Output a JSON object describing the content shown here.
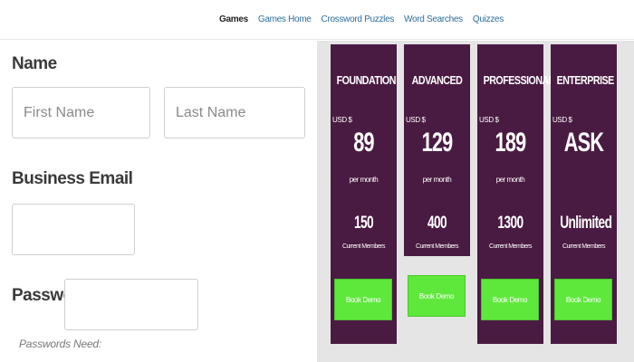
{
  "nav": {
    "items": [
      {
        "label": "Games",
        "active": true
      },
      {
        "label": "Games Home",
        "active": false
      },
      {
        "label": "Crossword Puzzles",
        "active": false
      },
      {
        "label": "Word Searches",
        "active": false
      },
      {
        "label": "Quizzes",
        "active": false
      }
    ]
  },
  "form": {
    "name_label": "Name",
    "first_name_placeholder": "First Name",
    "last_name_placeholder": "Last Name",
    "email_label": "Business Email",
    "password_label": "Password",
    "password_hint": "Passwords Need:"
  },
  "plans": [
    {
      "name": "FOUNDATION",
      "currency": "USD $",
      "price": "89",
      "period": "per month",
      "members": "150",
      "members_label": "Current Members",
      "cta": "Book Demo"
    },
    {
      "name": "ADVANCED",
      "currency": "USD $",
      "price": "129",
      "period": "per month",
      "members": "400",
      "members_label": "Current Members",
      "cta": "Book Demo"
    },
    {
      "name": "PROFESSIONAL",
      "currency": "USD $",
      "price": "189",
      "period": "per month",
      "members": "1300",
      "members_label": "Current Members",
      "cta": "Book Demo"
    },
    {
      "name": "ENTERPRISE",
      "currency": "USD $",
      "price": "ASK",
      "period": "",
      "members": "Unlimited",
      "members_label": "Current Members",
      "cta": "Book Demo"
    }
  ],
  "colors": {
    "card_bg": "#4a1b42",
    "cta_bg": "#5fe83c",
    "panel_bg": "#e5e5e5",
    "nav_link": "#2c6e9e"
  }
}
